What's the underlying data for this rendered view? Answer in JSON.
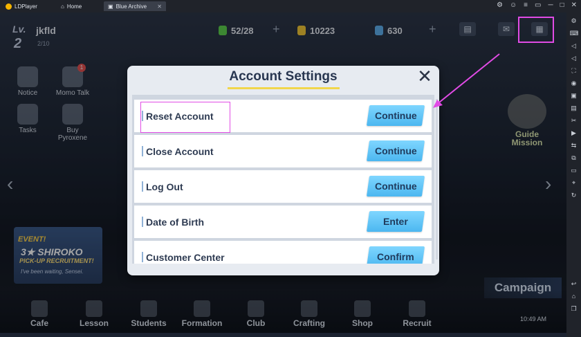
{
  "window": {
    "app_tab": "LDPlayer",
    "home_tab": "Home",
    "game_tab": "Blue Archive",
    "controls": [
      "⚙",
      "☺",
      "≡",
      "▭",
      "─",
      "□",
      "✕"
    ]
  },
  "player": {
    "level_label": "Lv.",
    "level": "2",
    "name": "jkfld",
    "exp": "2/10"
  },
  "resources": {
    "ap": "52/28",
    "credits": "10223",
    "pyroxene": "630"
  },
  "left_menu": {
    "notice": "Notice",
    "momotalk": "Momo Talk",
    "momotalk_badge": "1",
    "tasks": "Tasks",
    "buy_pyroxene": "Buy Pyroxene"
  },
  "guide_mission": {
    "line1": "Guide",
    "line2": "Mission"
  },
  "event": {
    "line1": "EVENT!",
    "line2": "3★ SHIROKO",
    "line3": "PICK-UP RECRUITMENT!",
    "line4": "I've been waiting, Sensei."
  },
  "campaign": "Campaign",
  "bottom_nav": [
    "Cafe",
    "Lesson",
    "Students",
    "Formation",
    "Club",
    "Crafting",
    "Shop",
    "Recruit"
  ],
  "clock": "10:49 AM",
  "modal": {
    "title": "Account Settings",
    "close": "✕",
    "rows": [
      {
        "label": "Reset Account",
        "button": "Continue"
      },
      {
        "label": "Close Account",
        "button": "Continue"
      },
      {
        "label": "Log Out",
        "button": "Continue"
      },
      {
        "label": "Date of Birth",
        "button": "Enter"
      },
      {
        "label": "Customer Center",
        "button": "Confirm"
      }
    ]
  },
  "colors": {
    "highlight": "#e14be5",
    "button": "#4cb7f0",
    "title_accent": "#f1d64b"
  }
}
